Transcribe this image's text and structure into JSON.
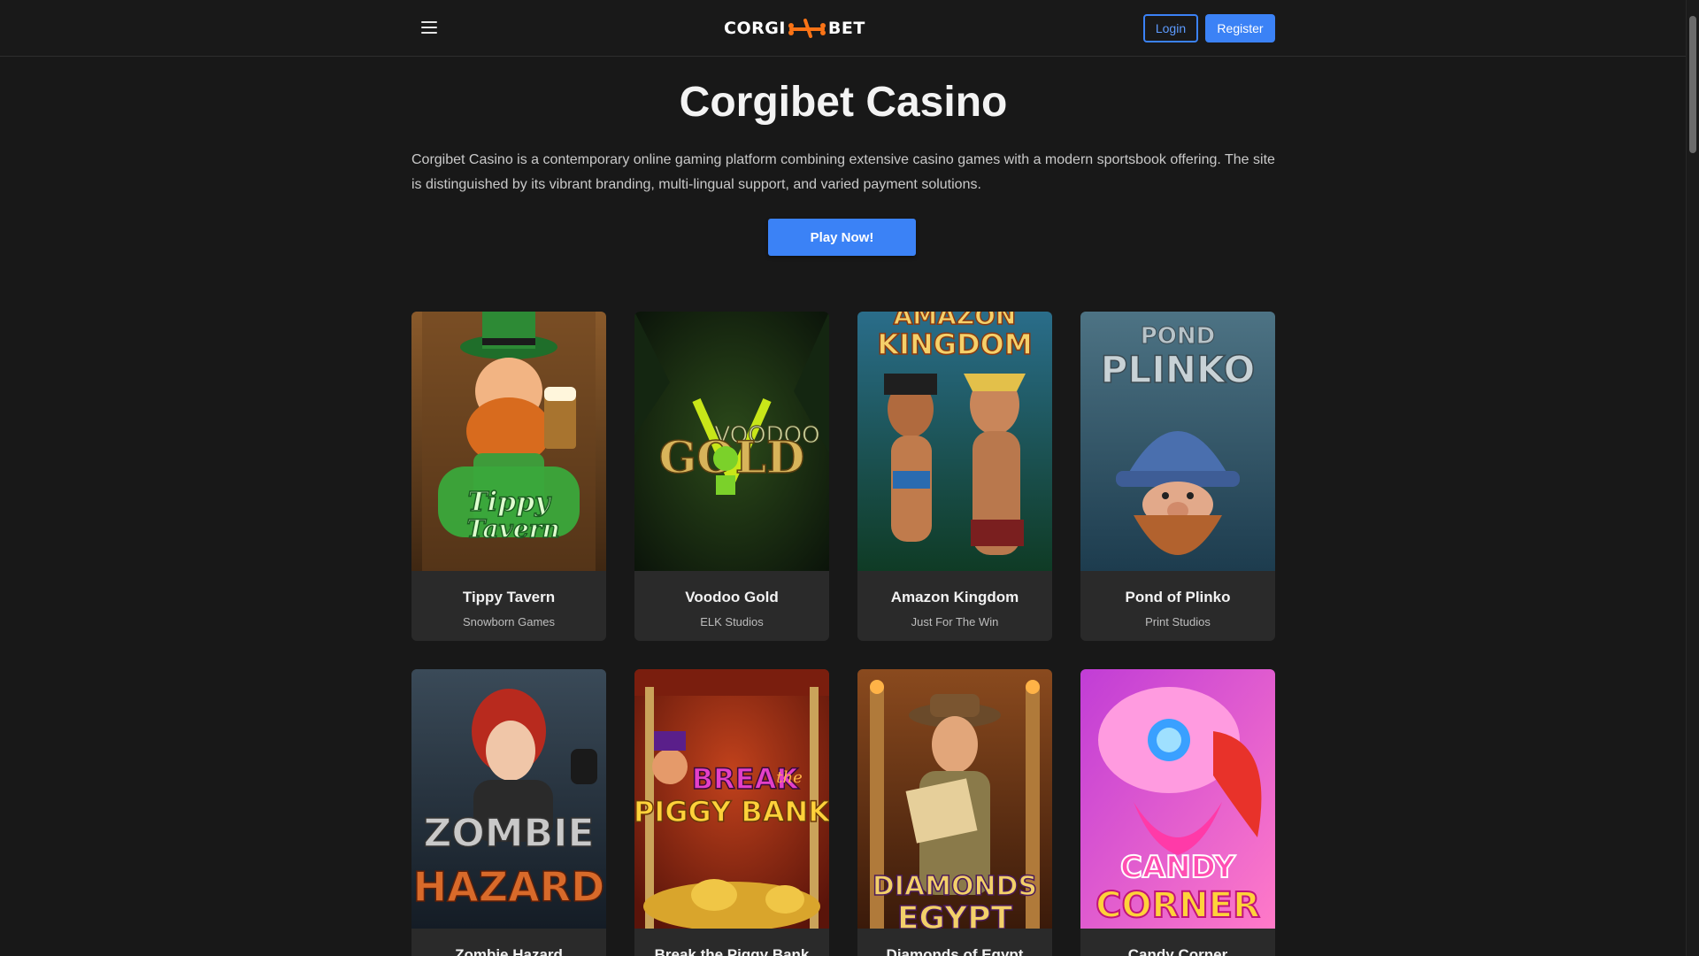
{
  "header": {
    "logo_left": "CORGI",
    "logo_right": "BET",
    "login_label": "Login",
    "register_label": "Register"
  },
  "hero": {
    "title": "Corgibet Casino",
    "description": "Corgibet Casino is a contemporary online gaming platform combining extensive casino games with a modern sportsbook offering. The site is distinguished by its vibrant branding, multi-lingual support, and varied payment solutions.",
    "cta_label": "Play Now!"
  },
  "games": [
    {
      "title": "Tippy Tavern",
      "provider": "Snowborn Games",
      "art_text": "Tippy Tavern"
    },
    {
      "title": "Voodoo Gold",
      "provider": "ELK Studios",
      "art_text": "VOODOO GOLD"
    },
    {
      "title": "Amazon Kingdom",
      "provider": "Just For The Win",
      "art_text": "AMAZON KINGDOM"
    },
    {
      "title": "Pond of Plinko",
      "provider": "Print Studios",
      "art_text": "PLINKO"
    },
    {
      "title": "Zombie Hazard",
      "provider": "",
      "art_text": "ZOMBIE HAZARD"
    },
    {
      "title": "Break the Piggy Bank",
      "provider": "",
      "art_text": "BREAK the PIGGY BANK"
    },
    {
      "title": "Diamonds of Egypt",
      "provider": "",
      "art_text": "DIAMONDS EGYPT"
    },
    {
      "title": "Candy Corner",
      "provider": "",
      "art_text": "CANDY CORNER"
    }
  ],
  "colors": {
    "accent": "#3b82f6",
    "background": "#181818",
    "card": "#2a2a2a",
    "logo_mark": "#f97316"
  }
}
